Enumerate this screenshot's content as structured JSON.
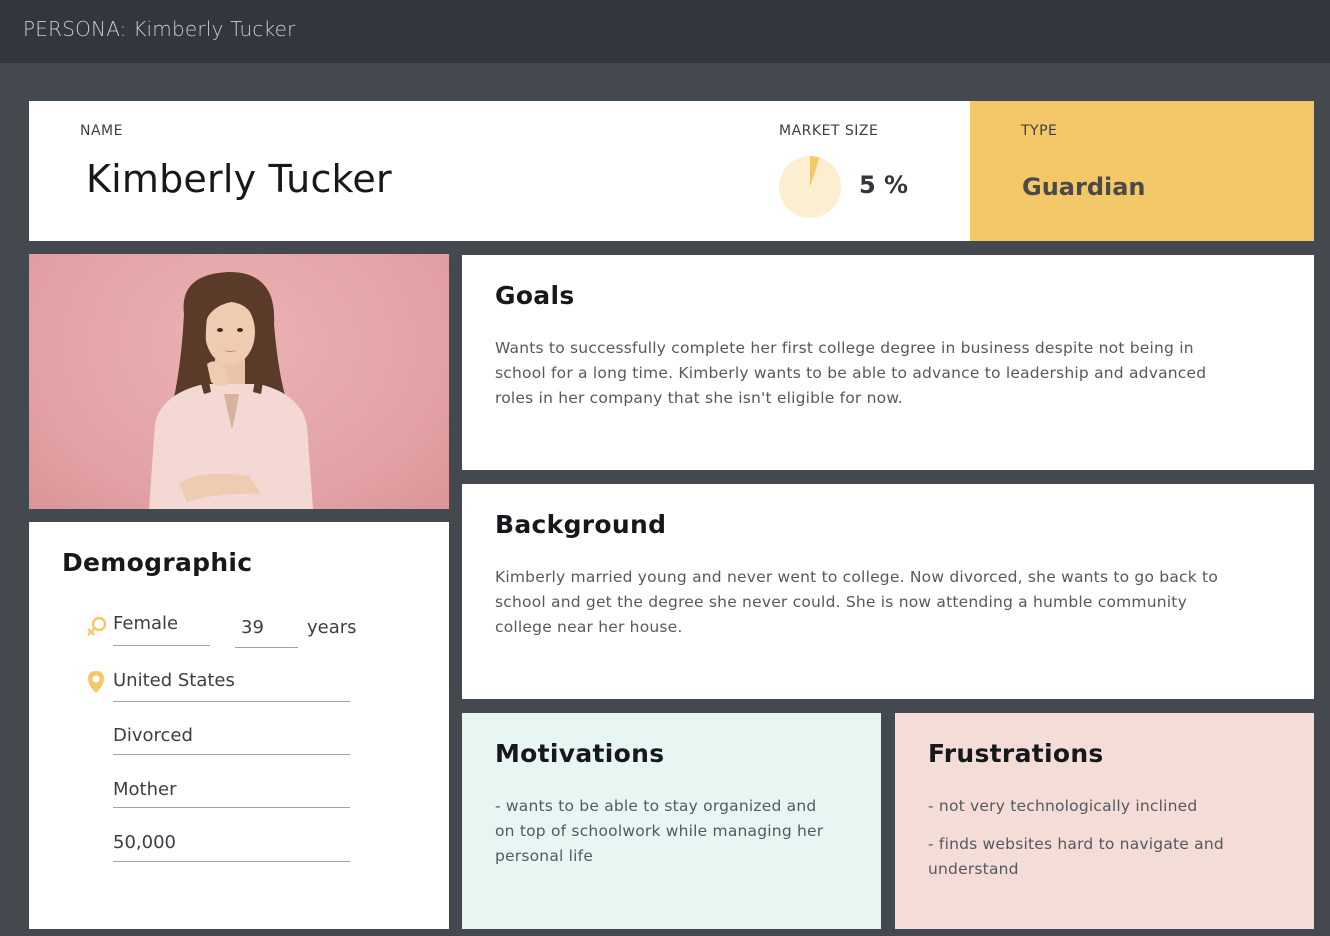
{
  "header": {
    "title": "PERSONA: Kimberly Tucker"
  },
  "name_card": {
    "name_label": "NAME",
    "name": "Kimberly Tucker"
  },
  "market": {
    "label": "MARKET SIZE",
    "value_text": "5 %",
    "percent": 5,
    "colors": {
      "slice": "#f4c869",
      "rest": "#fcefd1"
    }
  },
  "type_card": {
    "label": "TYPE",
    "value": "Guardian",
    "color": "#f4c869"
  },
  "photo": {
    "description_icon": "persona-photo"
  },
  "goals": {
    "title": "Goals",
    "lines": [
      "Wants to successfully complete her first college degree in business despite not being in",
      "school for a long time. Kimberly wants to be able to advance to leadership and advanced",
      "roles in her company that she isn't eligible for now."
    ]
  },
  "background": {
    "title": "Background",
    "lines": [
      "Kimberly married young and never went to college. Now divorced, she wants to go back to",
      "school and get the degree she never could. She is now attending a humble community",
      "college near her house."
    ]
  },
  "demographic": {
    "title": "Demographic",
    "gender": "Female",
    "age": "39",
    "age_unit": "years",
    "location": "United States",
    "marital_status": "Divorced",
    "role": "Mother",
    "income": "50,000",
    "icon_color": "#f4c869"
  },
  "motivations": {
    "title": "Motivations",
    "color": "#e8f6f3",
    "lines": [
      "- wants to be able to stay organized and",
      "on top of schoolwork while managing her",
      "personal life"
    ]
  },
  "frustrations": {
    "title": "Frustrations",
    "color": "#f4dcd7",
    "item1": "- not very technologically inclined",
    "item2_lines": [
      "- finds websites hard to navigate and",
      "understand"
    ]
  }
}
